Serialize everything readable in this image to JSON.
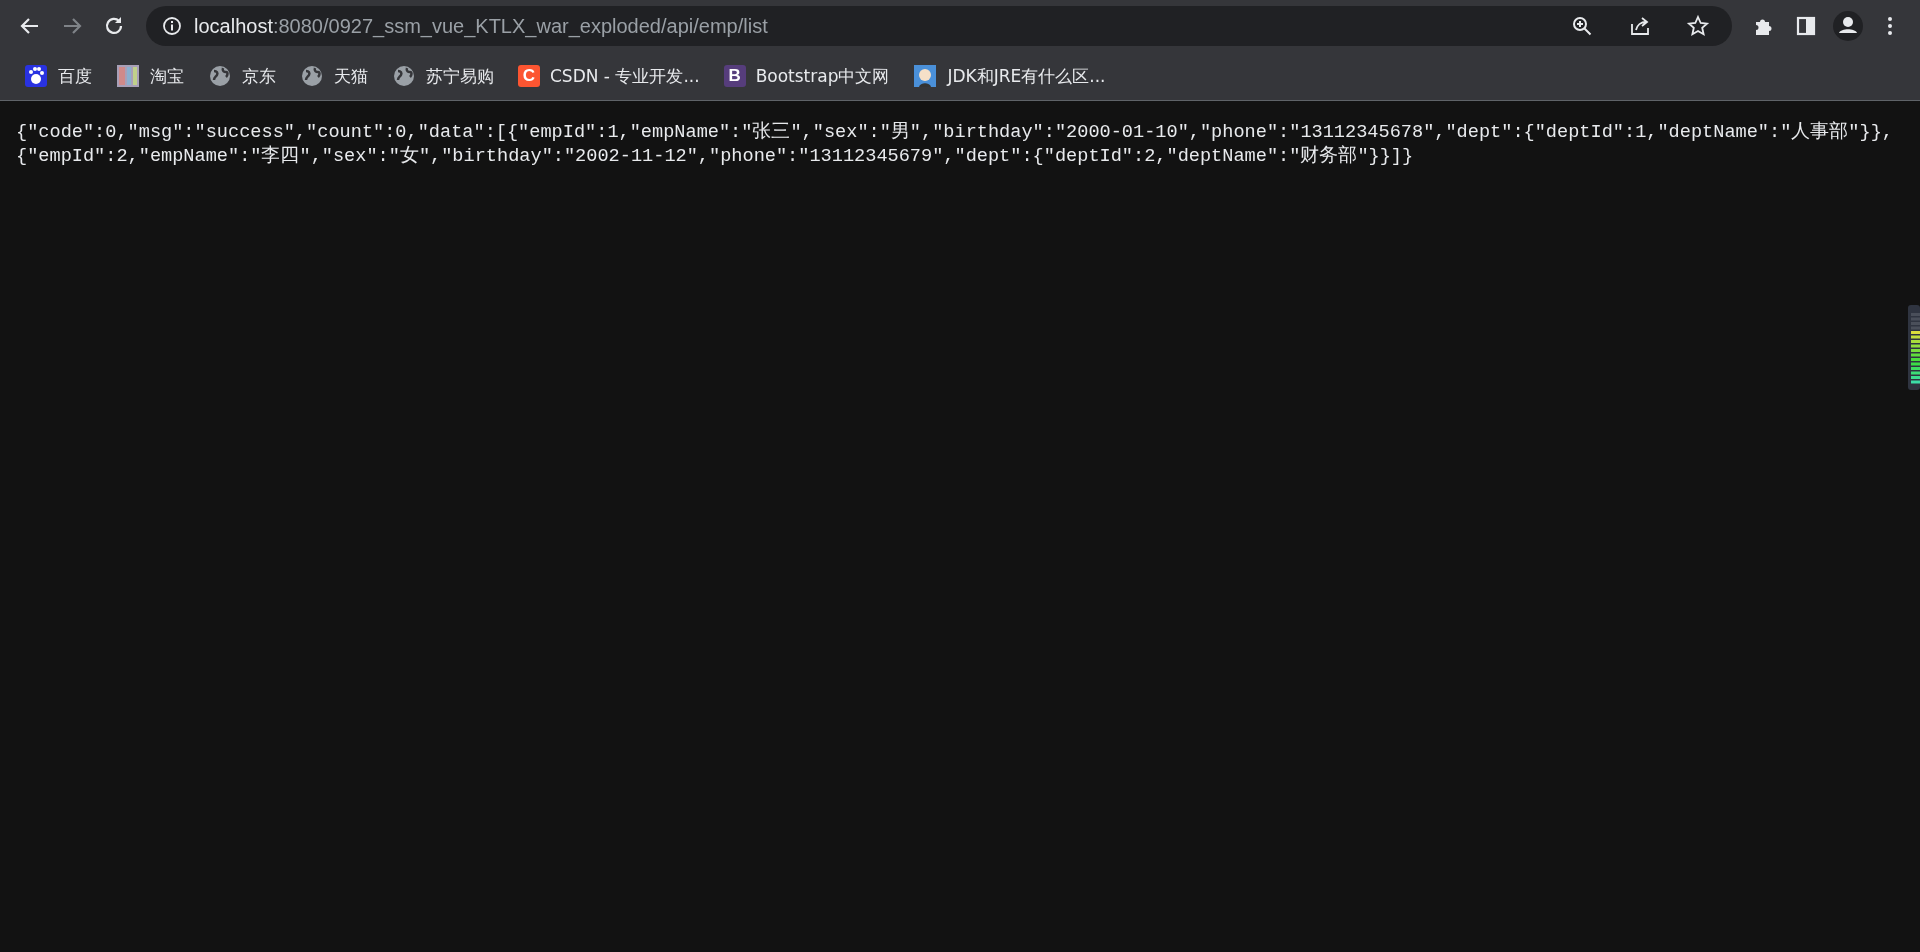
{
  "address_bar": {
    "host": "localhost",
    "path": ":8080/0927_ssm_vue_KTLX_war_exploded/api/emp/list"
  },
  "bookmarks": [
    {
      "label": "百度",
      "kind": "baidu"
    },
    {
      "label": "淘宝",
      "kind": "image"
    },
    {
      "label": "京东",
      "kind": "globe"
    },
    {
      "label": "天猫",
      "kind": "globe"
    },
    {
      "label": "苏宁易购",
      "kind": "globe"
    },
    {
      "label": "CSDN - 专业开发...",
      "kind": "letter",
      "letter": "C",
      "color": "#fc5531"
    },
    {
      "label": "Bootstrap中文网",
      "kind": "letter",
      "letter": "B",
      "color": "#563d7c"
    },
    {
      "label": "JDK和JRE有什么区...",
      "kind": "avatar"
    }
  ],
  "body_lines": [
    "{\"code\":0,\"msg\":\"success\",\"count\":0,\"data\":[{\"empId\":1,\"empName\":\"张三\",\"sex\":\"男\",\"birthday\":\"2000-01-10\",\"phone\":\"13112345678\",\"dept\":{\"deptId\":1,\"deptName\":\"人事部\"}},",
    "{\"empId\":2,\"empName\":\"李四\",\"sex\":\"女\",\"birthday\":\"2002-11-12\",\"phone\":\"13112345679\",\"dept\":{\"deptId\":2,\"deptName\":\"财务部\"}}]}"
  ]
}
